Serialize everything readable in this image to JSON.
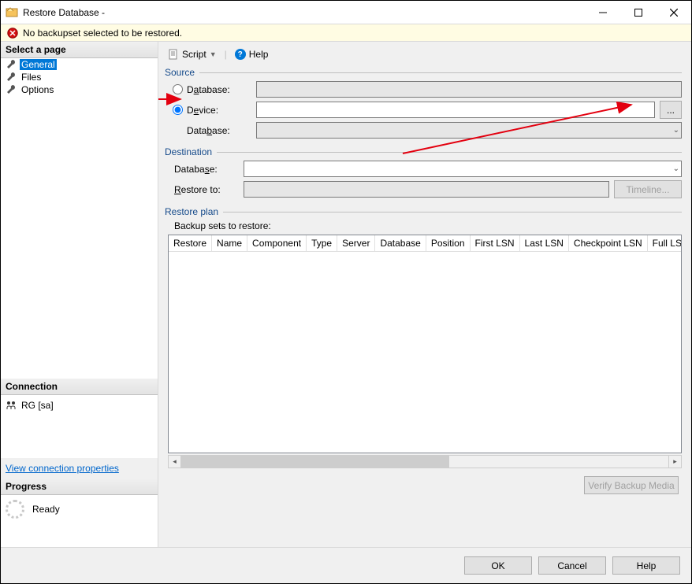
{
  "window": {
    "title": "Restore Database -"
  },
  "status": {
    "message": "No backupset selected to be restored."
  },
  "sidebar": {
    "header": "Select a page",
    "items": [
      {
        "label": "General"
      },
      {
        "label": "Files"
      },
      {
        "label": "Options"
      }
    ]
  },
  "connection": {
    "header": "Connection",
    "server": "RG [sa]",
    "link": "View connection properties"
  },
  "progress": {
    "header": "Progress",
    "status": "Ready"
  },
  "toolbar": {
    "script": "Script",
    "help": "Help"
  },
  "source": {
    "legend": "Source",
    "database_lbl": "Database:",
    "device_lbl": "Device:",
    "device_db_lbl": "Database:",
    "browse": "..."
  },
  "destination": {
    "legend": "Destination",
    "database_lbl": "Database:",
    "restoreto_lbl": "Restore to:",
    "timeline": "Timeline..."
  },
  "plan": {
    "legend": "Restore plan",
    "subtitle": "Backup sets to restore:",
    "verify": "Verify Backup Media",
    "columns": [
      "Restore",
      "Name",
      "Component",
      "Type",
      "Server",
      "Database",
      "Position",
      "First LSN",
      "Last LSN",
      "Checkpoint LSN",
      "Full LSN"
    ]
  },
  "footer": {
    "ok": "OK",
    "cancel": "Cancel",
    "help": "Help"
  }
}
